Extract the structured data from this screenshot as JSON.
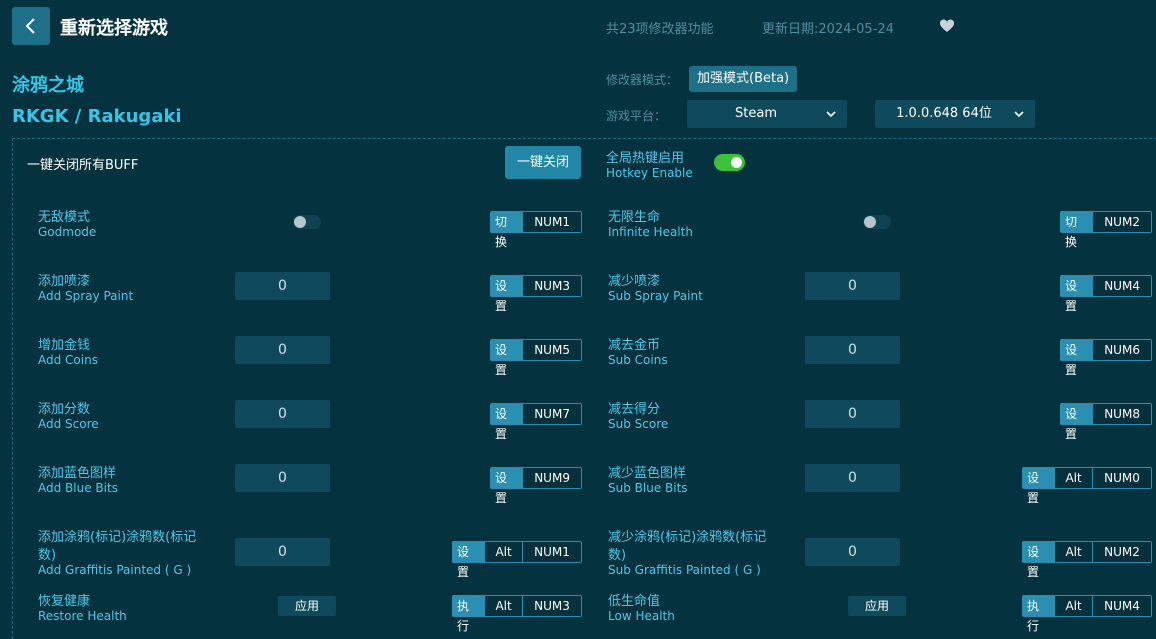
{
  "header": {
    "title": "重新选择游戏",
    "feature_count": "共23项修改器功能",
    "update_date": "更新日期:2024-05-24"
  },
  "game": {
    "title_cn": "涂鸦之城",
    "title_en": "RKGK / Rakugaki"
  },
  "settings": {
    "mode_label": "修改器模式：",
    "mode_value": "加强模式(Beta)",
    "platform_label": "游戏平台：",
    "platform_value": "Steam",
    "version_value": "1.0.0.648 64位"
  },
  "controls": {
    "close_all_label": "一键关闭所有BUFF",
    "close_all_button": "一键关闭",
    "hotkey_cn": "全局热键启用",
    "hotkey_en": "Hotkey Enable",
    "hotkey_enabled": true
  },
  "features": [
    {
      "cn": "无敌模式",
      "en": "Godmode",
      "control": "toggle",
      "value": "off",
      "action": "切换",
      "keys": [
        "NUM1"
      ]
    },
    {
      "cn": "无限生命",
      "en": "Infinite Health",
      "control": "toggle",
      "value": "off",
      "action": "切换",
      "keys": [
        "NUM2"
      ]
    },
    {
      "cn": "添加喷漆",
      "en": "Add Spray Paint",
      "control": "number",
      "value": "0",
      "action": "设置",
      "keys": [
        "NUM3"
      ]
    },
    {
      "cn": "减少喷漆",
      "en": "Sub Spray Paint",
      "control": "number",
      "value": "0",
      "action": "设置",
      "keys": [
        "NUM4"
      ]
    },
    {
      "cn": "增加金钱",
      "en": "Add Coins",
      "control": "number",
      "value": "0",
      "action": "设置",
      "keys": [
        "NUM5"
      ]
    },
    {
      "cn": "减去金币",
      "en": "Sub Coins",
      "control": "number",
      "value": "0",
      "action": "设置",
      "keys": [
        "NUM6"
      ]
    },
    {
      "cn": "添加分数",
      "en": "Add Score",
      "control": "number",
      "value": "0",
      "action": "设置",
      "keys": [
        "NUM7"
      ]
    },
    {
      "cn": "减去得分",
      "en": "Sub Score",
      "control": "number",
      "value": "0",
      "action": "设置",
      "keys": [
        "NUM8"
      ]
    },
    {
      "cn": "添加蓝色图样",
      "en": "Add Blue Bits",
      "control": "number",
      "value": "0",
      "action": "设置",
      "keys": [
        "NUM9"
      ]
    },
    {
      "cn": "减少蓝色图样",
      "en": "Sub Blue Bits",
      "control": "number",
      "value": "0",
      "action": "设置",
      "keys": [
        "Alt",
        "NUM0"
      ]
    },
    {
      "cn1": "添加涂鸦(标记)涂鸦数(标记",
      "cn2": "数)",
      "en": "Add Graffitis Painted ( G )",
      "control": "number",
      "value": "0",
      "action": "设置",
      "keys": [
        "Alt",
        "NUM1"
      ]
    },
    {
      "cn1": "减少涂鸦(标记)涂鸦数(标记",
      "cn2": "数)",
      "en": "Sub Graffitis Painted ( G )",
      "control": "number",
      "value": "0",
      "action": "设置",
      "keys": [
        "Alt",
        "NUM2"
      ]
    },
    {
      "cn": "恢复健康",
      "en": "Restore Health",
      "control": "button",
      "label": "应用",
      "action": "执行",
      "keys": [
        "Alt",
        "NUM3"
      ]
    },
    {
      "cn": "低生命值",
      "en": "Low Health",
      "control": "button",
      "label": "应用",
      "action": "执行",
      "keys": [
        "Alt",
        "NUM4"
      ]
    }
  ],
  "icons": {
    "back": "chevron-left-icon",
    "favorite": "heart-icon",
    "dropdown": "chevron-down-icon"
  },
  "colors": {
    "background": "#05323f",
    "accent": "#1e6f88",
    "label": "#4ec8ea",
    "toggle_on": "#3bc23a"
  }
}
